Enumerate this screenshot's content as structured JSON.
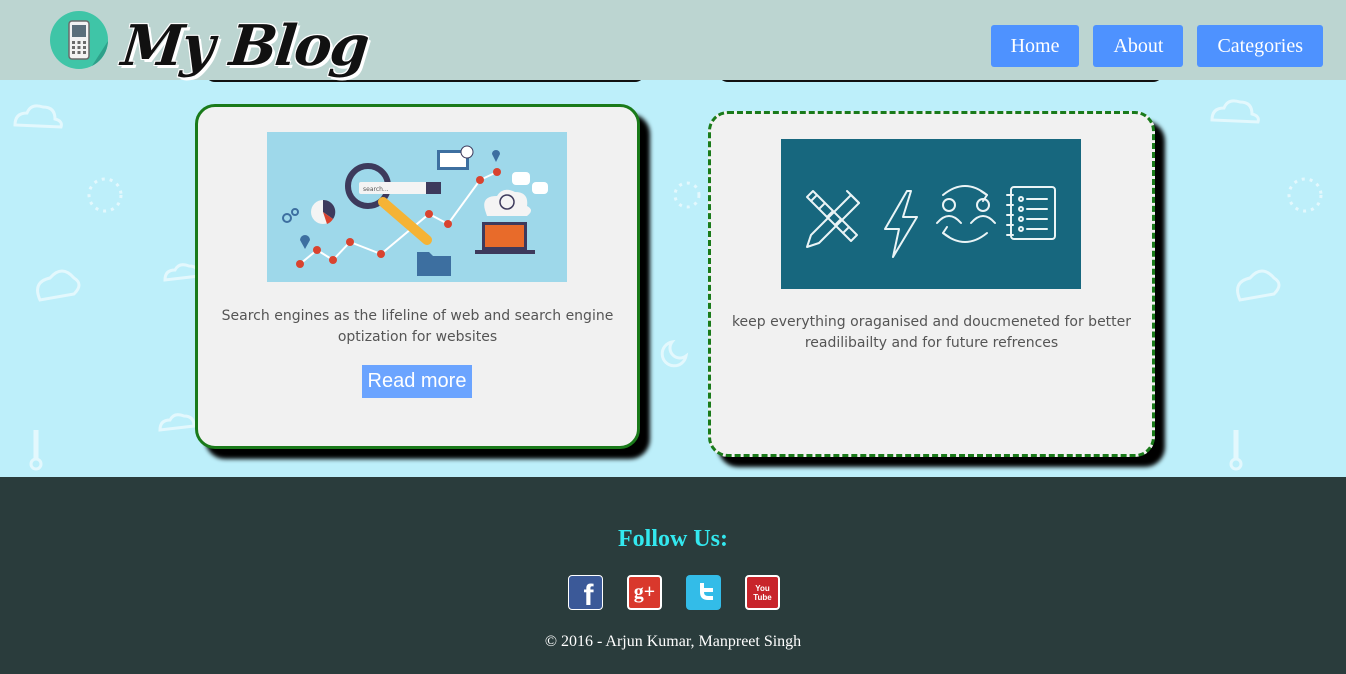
{
  "header": {
    "logo_text": "My Blog",
    "nav": [
      {
        "label": "Home"
      },
      {
        "label": "About"
      },
      {
        "label": "Categories"
      }
    ]
  },
  "cards": [
    {
      "text": "Search engines as the lifeline of web and search engine optization for websites",
      "button": "Read more",
      "image_search_text": "search...",
      "icon": "seo-search-illustration-icon"
    },
    {
      "text": "keep everything oraganised and doucmeneted for better readilibailty and for future refrences",
      "icon": "tools-documentation-illustration-icon"
    }
  ],
  "footer": {
    "follow_label": "Follow Us:",
    "socials": [
      {
        "icon": "facebook-icon",
        "text": "f"
      },
      {
        "icon": "google-plus-icon",
        "text": "g+"
      },
      {
        "icon": "twitter-icon"
      },
      {
        "icon": "youtube-icon",
        "text": "You Tube"
      }
    ],
    "copyright": "© 2016 - Arjun Kumar, Manpreet Singh"
  },
  "colors": {
    "header_bg": "#bcd5d1",
    "page_bg": "#bdeffa",
    "nav_button": "#4e92ff",
    "card_border": "#1a7a1a",
    "footer_bg": "#2a3c3c",
    "follow_text": "#33e8ef"
  }
}
